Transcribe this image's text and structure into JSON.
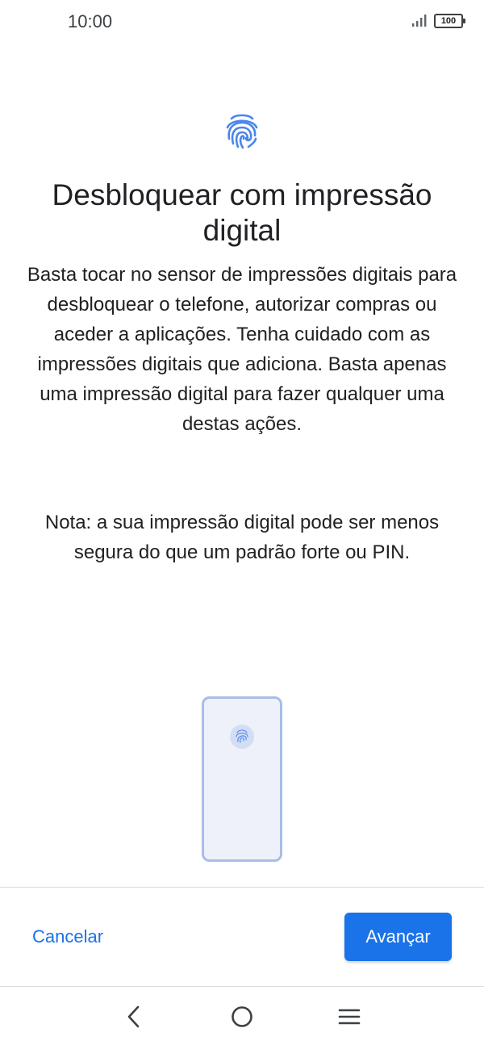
{
  "status_bar": {
    "time": "10:00",
    "battery_level": "100",
    "icons": [
      "signal-icon",
      "battery-icon"
    ]
  },
  "screen": {
    "header_icon": "fingerprint-icon",
    "title": "Desbloquear com impressão digital",
    "description": "Basta tocar no sensor de impressões digitais para desbloquear o telefone, autorizar compras ou aceder a aplicações. Tenha cuidado com as impressões digitais que adiciona. Basta apenas uma impressão digital para fazer qualquer uma destas ações.",
    "note": "Nota: a sua impressão digital pode ser menos segura do que um padrão forte ou PIN.",
    "illustration": "phone-fingerprint-sensor-illustration"
  },
  "actions": {
    "cancel_label": "Cancelar",
    "next_label": "Avançar"
  },
  "navigation": {
    "buttons": [
      "back-icon",
      "home-icon",
      "menu-icon"
    ]
  },
  "colors": {
    "accent": "#1a73e8",
    "icon_blue": "#4a86e8",
    "phone_fill": "#eef1fa",
    "phone_border": "#a9bde6"
  }
}
